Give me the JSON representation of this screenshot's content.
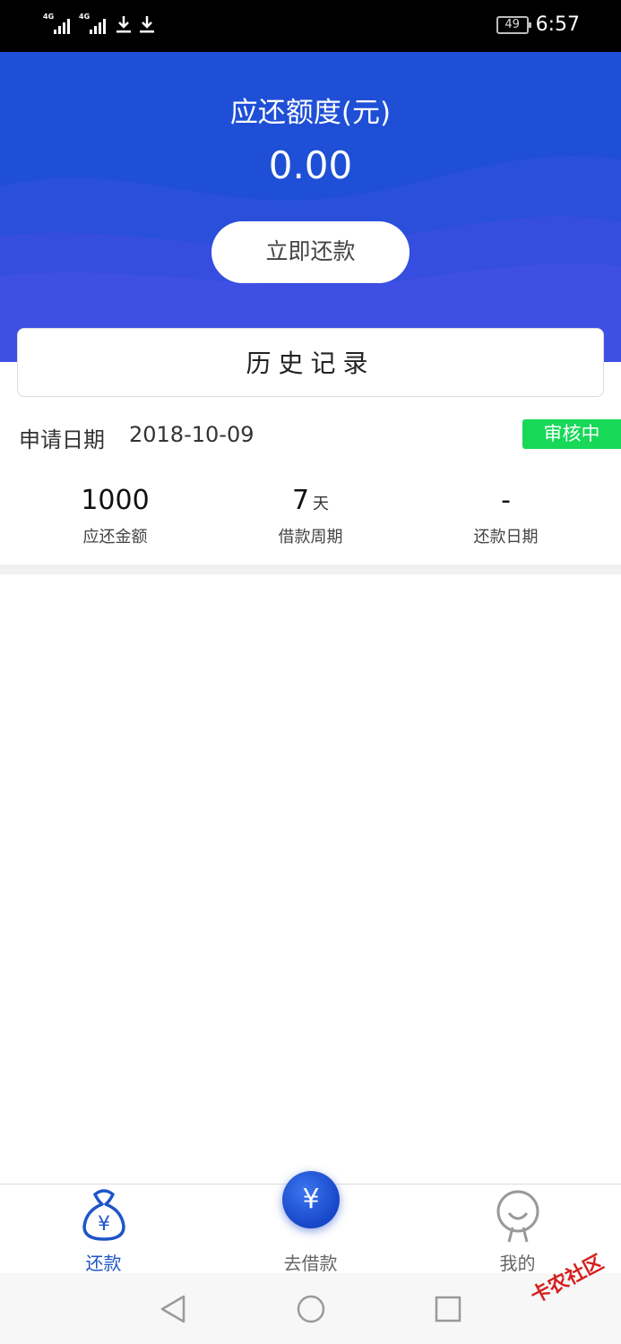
{
  "status_bar": {
    "signal1": "4G",
    "signal2": "4G",
    "battery": "49",
    "time": "6:57"
  },
  "hero": {
    "title": "应还额度(元)",
    "amount": "0.00",
    "repay_button": "立即还款"
  },
  "history": {
    "title": "历史记录"
  },
  "record": {
    "apply_label": "申请日期",
    "apply_date": "2018-10-09",
    "status": "审核中",
    "amount_value": "1000",
    "amount_label": "应还金额",
    "period_value": "7",
    "period_unit": "天",
    "period_label": "借款周期",
    "repay_date_value": "-",
    "repay_date_label": "还款日期"
  },
  "bottom_nav": {
    "repay": "还款",
    "borrow": "去借款",
    "borrow_symbol": "¥",
    "repay_symbol": "¥",
    "mine": "我的"
  },
  "watermark": "卡农社区",
  "colors": {
    "primary_blue": "#1e4fd6",
    "badge_green": "#17d857",
    "nav_active": "#1e55c8"
  },
  "icons": [
    "signal-icon",
    "download-icon",
    "battery-icon",
    "money-bag-icon",
    "yuan-icon",
    "smile-face-icon",
    "back-triangle-icon",
    "home-circle-icon",
    "recents-square-icon"
  ]
}
